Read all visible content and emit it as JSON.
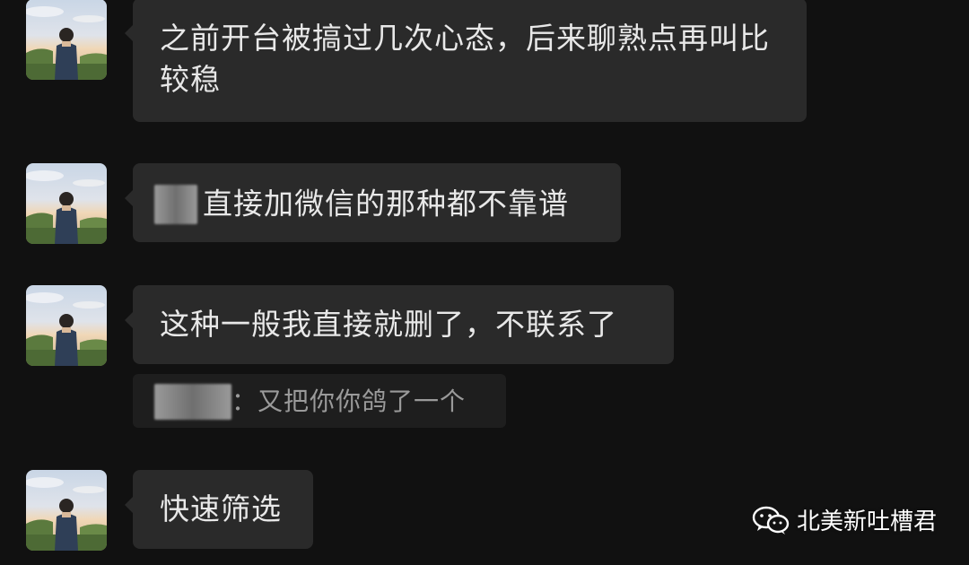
{
  "messages": [
    {
      "text": "之前开台被搞过几次心态，后来聊熟点再叫比较稳"
    },
    {
      "text": "直接加微信的那种都不靠谱"
    },
    {
      "text": "这种一般我直接就删了，不联系了"
    },
    {
      "text": "快速筛选"
    }
  ],
  "quote": {
    "separator": "：",
    "text": "又把你你鸽了一个"
  },
  "watermark": {
    "text": "北美新吐槽君",
    "icon": "wechat-icon"
  },
  "colors": {
    "background": "#111111",
    "bubble": "#2a2a2a",
    "quote_bg": "#1e1e1e",
    "quote_text": "#9a9a9a"
  }
}
